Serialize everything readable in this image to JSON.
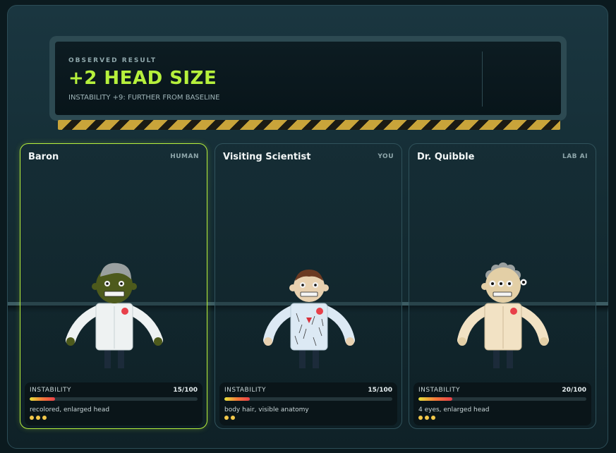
{
  "banner": {
    "label": "OBSERVED RESULT",
    "value": "+2 HEAD SIZE",
    "subtext": "INSTABILITY +9: FURTHER FROM BASELINE"
  },
  "cards": [
    {
      "name": "Baron",
      "role": "HUMAN",
      "instability_label": "INSTABILITY",
      "instability_text": "15/100",
      "instability": 15,
      "traits": "recolored, enlarged head",
      "pips": 3,
      "skin_color": "#4d5a1c",
      "hair": "gray-swoop-hair"
    },
    {
      "name": "Visiting Scientist",
      "role": "YOU",
      "instability_label": "INSTABILITY",
      "instability_text": "15/100",
      "instability": 15,
      "traits": "body hair, visible anatomy",
      "pips": 2,
      "skin_color": "#e8d1b0",
      "hair": "brown-hair"
    },
    {
      "name": "Dr. Quibble",
      "role": "LAB AI",
      "instability_label": "INSTABILITY",
      "instability_text": "20/100",
      "instability": 20,
      "traits": "4 eyes, enlarged head",
      "pips": 3,
      "skin_color": "#e3cfa6",
      "hair": "gray-curly-hair"
    }
  ],
  "colors": {
    "accent": "#b6f03c",
    "pip": "#f3c84a",
    "hazard": "#c9a43a"
  }
}
